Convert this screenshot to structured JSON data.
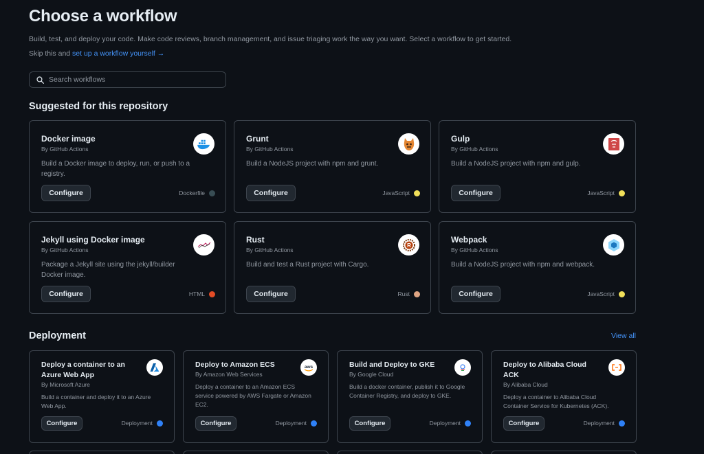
{
  "page": {
    "title": "Choose a workflow",
    "intro": "Build, test, and deploy your code. Make code reviews, branch management, and issue triaging work the way you want. Select a workflow to get started.",
    "skip_prefix": "Skip this and ",
    "skip_link": "set up a workflow yourself",
    "skip_arrow": "→"
  },
  "search": {
    "placeholder": "Search workflows"
  },
  "suggested": {
    "title": "Suggested for this repository",
    "cards": [
      {
        "name": "Docker image",
        "by": "By GitHub Actions",
        "desc": "Build a Docker image to deploy, run, or push to a registry.",
        "button": "Configure",
        "lang": "Dockerfile",
        "lang_color": "#384d54",
        "icon": "docker-icon"
      },
      {
        "name": "Grunt",
        "by": "By GitHub Actions",
        "desc": "Build a NodeJS project with npm and grunt.",
        "button": "Configure",
        "lang": "JavaScript",
        "lang_color": "#f1e05a",
        "icon": "grunt-icon"
      },
      {
        "name": "Gulp",
        "by": "By GitHub Actions",
        "desc": "Build a NodeJS project with npm and gulp.",
        "button": "Configure",
        "lang": "JavaScript",
        "lang_color": "#f1e05a",
        "icon": "gulp-icon"
      },
      {
        "name": "Jekyll using Docker image",
        "by": "By GitHub Actions",
        "desc": "Package a Jekyll site using the jekyll/builder Docker image.",
        "button": "Configure",
        "lang": "HTML",
        "lang_color": "#e34c26",
        "icon": "jekyll-icon"
      },
      {
        "name": "Rust",
        "by": "By GitHub Actions",
        "desc": "Build and test a Rust project with Cargo.",
        "button": "Configure",
        "lang": "Rust",
        "lang_color": "#dea584",
        "icon": "rust-icon"
      },
      {
        "name": "Webpack",
        "by": "By GitHub Actions",
        "desc": "Build a NodeJS project with npm and webpack.",
        "button": "Configure",
        "lang": "JavaScript",
        "lang_color": "#f1e05a",
        "icon": "webpack-icon"
      }
    ]
  },
  "deployment": {
    "title": "Deployment",
    "view_all": "View all",
    "cards": [
      {
        "name": "Deploy a container to an Azure Web App",
        "by": "By Microsoft Azure",
        "desc": "Build a container and deploy it to an Azure Web App.",
        "button": "Configure",
        "lang": "Deployment",
        "icon": "azure-icon"
      },
      {
        "name": "Deploy to Amazon ECS",
        "by": "By Amazon Web Services",
        "desc": "Deploy a container to an Amazon ECS service powered by AWS Fargate or Amazon EC2.",
        "button": "Configure",
        "lang": "Deployment",
        "icon": "aws-icon"
      },
      {
        "name": "Build and Deploy to GKE",
        "by": "By Google Cloud",
        "desc": "Build a docker container, publish it to Google Container Registry, and deploy to GKE.",
        "button": "Configure",
        "lang": "Deployment",
        "icon": "google-cloud-icon"
      },
      {
        "name": "Deploy to Alibaba Cloud ACK",
        "by": "By Alibaba Cloud",
        "desc": "Deploy a container to Alibaba Cloud Container Service for Kubernetes (ACK).",
        "button": "Configure",
        "lang": "Deployment",
        "icon": "alibaba-cloud-icon"
      }
    ]
  },
  "colors": {
    "background": "#0d1117",
    "border": "#3d444d",
    "link": "#4493f8",
    "muted": "#9198a1",
    "deployment_dot": "#2f81f7"
  }
}
